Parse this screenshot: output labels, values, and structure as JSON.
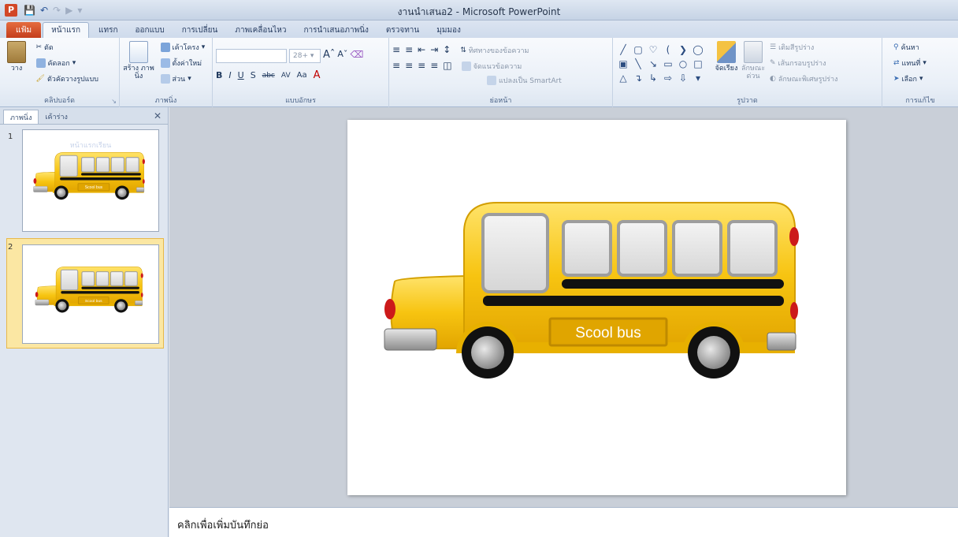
{
  "app": {
    "icon_letter": "P",
    "window_title": "งานนำเสนอ2 - Microsoft PowerPoint"
  },
  "tabs": [
    {
      "label": "แฟ้ม"
    },
    {
      "label": "หน้าแรก"
    },
    {
      "label": "แทรก"
    },
    {
      "label": "ออกแบบ"
    },
    {
      "label": "การเปลี่ยน"
    },
    {
      "label": "ภาพเคลื่อนไหว"
    },
    {
      "label": "การนำเสนอภาพนิ่ง"
    },
    {
      "label": "ตรวจทาน"
    },
    {
      "label": "มุมมอง"
    }
  ],
  "ribbon": {
    "clipboard": {
      "paste": "วาง",
      "cut": "ตัด",
      "copy": "คัดลอก",
      "format_painter": "ตัวคัดวางรูปแบบ",
      "label": "คลิปบอร์ด"
    },
    "slides": {
      "new_slide": "สร้าง ภาพนิ่ง",
      "layout": "เค้าโครง",
      "reset": "ตั้งค่าใหม่",
      "section": "ส่วน",
      "label": "ภาพนิ่ง"
    },
    "font": {
      "size": "28+",
      "label": "แบบอักษร"
    },
    "paragraph": {
      "text_direction": "ทิศทางของข้อความ",
      "align_text": "จัดแนวข้อความ",
      "smartart": "แปลงเป็น SmartArt",
      "label": "ย่อหน้า"
    },
    "drawing": {
      "arrange": "จัดเรียง",
      "quick_styles": "ลักษณะด่วน",
      "shape_fill": "เติมสีรูปร่าง",
      "shape_outline": "เส้นกรอบรูปร่าง",
      "shape_effects": "ลักษณะพิเศษรูปร่าง",
      "label": "รูปวาด"
    },
    "editing": {
      "find": "ค้นหา",
      "replace": "แทนที่",
      "select": "เลือก",
      "label": "การแก้ไข"
    }
  },
  "left_pane": {
    "tab_slides": "ภาพนิ่ง",
    "tab_outline": "เค้าร่าง",
    "slides": [
      {
        "number": "1",
        "title": "หน้าแรกเรียน",
        "bus_label": "Scool bus",
        "selected": false
      },
      {
        "number": "2",
        "title": "",
        "bus_label": "Scool bus",
        "selected": true
      }
    ]
  },
  "slide": {
    "bus_label": "Scool bus"
  },
  "notes": {
    "placeholder": "คลิกเพื่อเพิ่มบันทึกย่อ"
  },
  "colors": {
    "accent_file_tab": "#d24726",
    "bus_yellow": "#f7c411",
    "selection_gold": "#f6c544"
  }
}
